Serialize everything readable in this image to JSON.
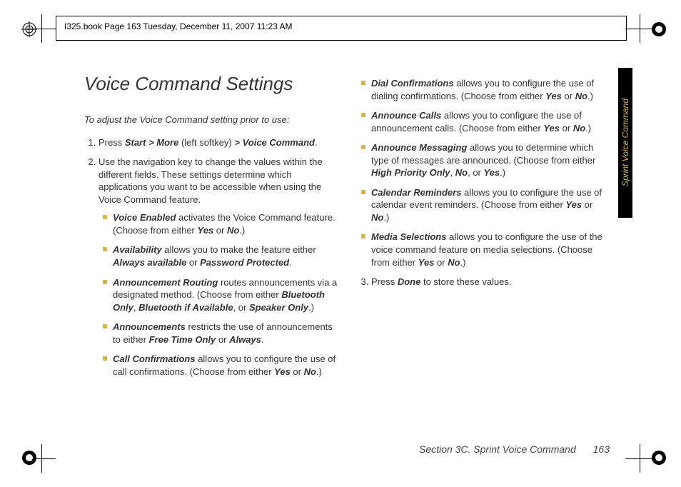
{
  "header": {
    "book_line": "I325.book  Page 163  Tuesday, December 11, 2007  11:23 AM"
  },
  "title": "Voice Command Settings",
  "intro": "To adjust the Voice Command setting prior to use:",
  "steps": {
    "s1": {
      "pre": "Press ",
      "b1": "Start > More",
      "mid1": " (left softkey) ",
      "b2": "> Voice Command",
      "post": "."
    },
    "s2": "Use the navigation key to change the values within the different fields. These settings determine which applications you want to be accessible when using the Voice Command feature.",
    "s3": {
      "pre": "Press ",
      "b1": "Done",
      "post": " to store these values."
    }
  },
  "bullets_col1": {
    "b0": {
      "t": "Voice Enabled",
      "text1": " activates the Voice Command feature. (Choose from either ",
      "o1": "Yes",
      "mid": " or ",
      "o2": "No",
      "post": ".)"
    },
    "b1": {
      "t": "Availability",
      "text1": " allows you to make the feature either ",
      "o1": "Always available",
      "mid": " or ",
      "o2": "Password Protected",
      "post": "."
    },
    "b2": {
      "t": "Announcement Routing",
      "text1": " routes announcements via a designated method. (Choose from either ",
      "o1": "Bluetooth Only",
      "c1": ", ",
      "o2": "Bluetooth if Available",
      "c2": ", or ",
      "o3": "Speaker Only",
      "post": ".)"
    },
    "b3": {
      "t": "Announcements",
      "text1": " restricts the use of announcements to either ",
      "o1": "Free Time Only",
      "mid": " or ",
      "o2": "Always",
      "post": "."
    },
    "b4": {
      "t": "Call Confirmations",
      "text1": " allows you to configure the use of call confirmations. (Choose from either ",
      "o1": "Yes",
      "mid": " or ",
      "o2": "No",
      "post": ".)"
    }
  },
  "bullets_col2": {
    "b0": {
      "t": "Dial Confirmations",
      "text1": " allows you to configure the use of dialing confirmations. (Choose from either ",
      "o1": "Yes",
      "mid": " or ",
      "o2": "No",
      "post": ".)"
    },
    "b1": {
      "t": "Announce Calls",
      "text1": " allows you to configure the use of announcement calls. (Choose from either ",
      "o1": "Yes",
      "mid": " or ",
      "o2": "No",
      "post": ".)"
    },
    "b2": {
      "t": "Announce Messaging",
      "text1": " allows you to determine which type of messages are announced. (Choose from either ",
      "o1": "High Priority Only",
      "c1": ", ",
      "o2": "No",
      "c2": ", or ",
      "o3": "Yes",
      "post": ".)"
    },
    "b3": {
      "t": "Calendar Reminders",
      "text1": " allows you to configure the use of calendar event reminders. (Choose from either ",
      "o1": "Yes",
      "mid": " or ",
      "o2": "No",
      "post": ".)"
    },
    "b4": {
      "t": "Media Selections",
      "text1": " allows you to configure the use of the voice command feature on media selections. (Choose from either ",
      "o1": "Yes",
      "mid": " or ",
      "o2": "No",
      "post": ".)"
    }
  },
  "footer": {
    "section": "Section 3C. Sprint Voice Command",
    "page": "163"
  },
  "side_tab": "Sprint Voice Command"
}
